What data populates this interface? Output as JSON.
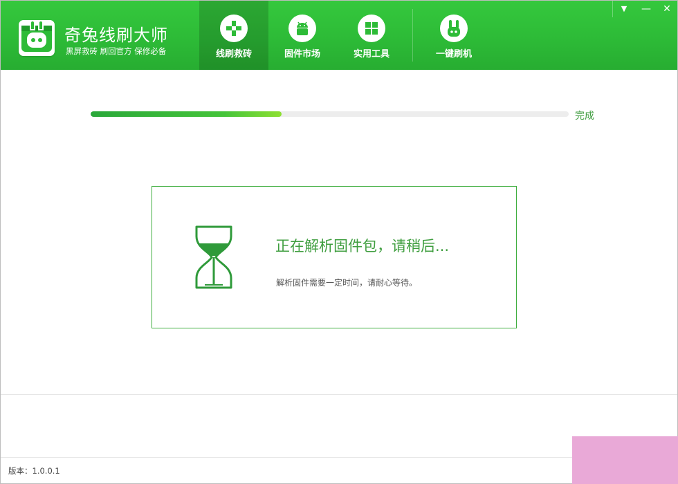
{
  "app": {
    "title": "奇兔线刷大师",
    "slogan": "黑屏救砖  刷回官方  保修必备"
  },
  "nav": {
    "tabs": [
      {
        "label": "线刷救砖",
        "icon": "plus-icon",
        "active": true
      },
      {
        "label": "固件市场",
        "icon": "android-icon",
        "active": false
      },
      {
        "label": "实用工具",
        "icon": "grid-icon",
        "active": false
      },
      {
        "label": "一键刷机",
        "icon": "rabbit-icon",
        "active": false
      }
    ]
  },
  "window_controls": {
    "menu_glyph": "▼",
    "minimize_glyph": "—",
    "close_glyph": "✕"
  },
  "progress": {
    "fraction": 0.4,
    "label": "完成"
  },
  "status": {
    "title": "正在解析固件包，请稍后...",
    "description": "解析固件需要一定时间，请耐心等待。",
    "icon": "hourglass-icon"
  },
  "footer": {
    "version": "版本：1.0.0.1"
  },
  "colors": {
    "brand_green": "#2dbb37",
    "accent_green": "#3f9e3f",
    "corner_patch": "#e9a9d7"
  }
}
